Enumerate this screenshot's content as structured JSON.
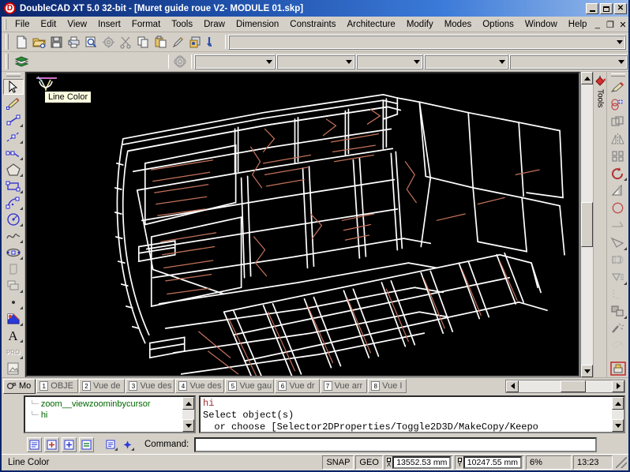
{
  "window": {
    "title": "DoubleCAD XT 5.0 32-bit - [Muret guide roue V2- MODULE 01.skp]",
    "logo": "D",
    "minimize": "_",
    "maximize": "□",
    "close": "✕"
  },
  "menu": {
    "items": [
      {
        "label": "File"
      },
      {
        "label": "Edit"
      },
      {
        "label": "View"
      },
      {
        "label": "Insert"
      },
      {
        "label": "Format"
      },
      {
        "label": "Tools"
      },
      {
        "label": "Draw"
      },
      {
        "label": "Dimension"
      },
      {
        "label": "Constraints"
      },
      {
        "label": "Architecture"
      },
      {
        "label": "Modify"
      },
      {
        "label": "Modes"
      },
      {
        "label": "Options"
      },
      {
        "label": "Window"
      },
      {
        "label": "Help"
      }
    ],
    "mdi": {
      "minimize": "_",
      "restore": "❐",
      "close": "✕"
    }
  },
  "toolbar_main": {
    "buttons": [
      {
        "name": "new-icon",
        "title": "New"
      },
      {
        "name": "open-icon",
        "title": "Open"
      },
      {
        "name": "save-icon",
        "title": "Save"
      },
      {
        "name": "print-icon",
        "title": "Print"
      },
      {
        "name": "print-preview-icon",
        "title": "Print Preview"
      },
      {
        "name": "settings-icon",
        "title": "Settings"
      },
      {
        "name": "cut-icon",
        "title": "Cut"
      },
      {
        "name": "copy-icon",
        "title": "Copy"
      },
      {
        "name": "paste-icon",
        "title": "Paste"
      },
      {
        "name": "format-painter-icon",
        "title": "Format Painter"
      },
      {
        "name": "paste-special-icon",
        "title": "Paste Special"
      },
      {
        "name": "undo-icon",
        "title": "Undo"
      }
    ],
    "style_combo_value": ""
  },
  "toolbar_props": {
    "layer_icon": "layers-icon",
    "pattern_icon": "pattern-icon",
    "combos": [
      {
        "name": "layer-combo",
        "value": ""
      },
      {
        "name": "color-combo",
        "value": ""
      },
      {
        "name": "linestyle-combo",
        "value": ""
      },
      {
        "name": "lineweight-combo",
        "value": ""
      },
      {
        "name": "textstyle-combo",
        "value": ""
      }
    ]
  },
  "left_toolbar": {
    "tools": [
      {
        "name": "select-tool",
        "glyph": "arrow",
        "active": true,
        "flyout": false
      },
      {
        "name": "pencil-tool",
        "glyph": "pencil",
        "active": false,
        "flyout": false
      },
      {
        "name": "line-tool",
        "glyph": "line",
        "active": false,
        "flyout": true
      },
      {
        "name": "construction-line-tool",
        "glyph": "cline",
        "active": false,
        "flyout": true
      },
      {
        "name": "polyline-tool",
        "glyph": "polyline",
        "active": false,
        "flyout": true
      },
      {
        "name": "polygon-tool",
        "glyph": "polygon",
        "active": false,
        "flyout": true
      },
      {
        "name": "rectangle-tool",
        "glyph": "rect",
        "active": false,
        "flyout": true
      },
      {
        "name": "arc-tool",
        "glyph": "arc",
        "active": false,
        "flyout": true
      },
      {
        "name": "circle-tool",
        "glyph": "circle",
        "active": false,
        "flyout": true
      },
      {
        "name": "spline-tool",
        "glyph": "spline",
        "active": false,
        "flyout": true
      },
      {
        "name": "ellipse-tool",
        "glyph": "ellipse",
        "active": false,
        "flyout": true
      },
      {
        "name": "curve-text-tool",
        "glyph": "qglyph",
        "active": false,
        "flyout": false
      },
      {
        "name": "solid-tool",
        "glyph": "solid",
        "active": false,
        "flyout": true
      },
      {
        "name": "point-tool",
        "glyph": "point",
        "active": false,
        "flyout": true
      },
      {
        "name": "hatch-tool",
        "glyph": "hatch",
        "active": false,
        "flyout": true
      },
      {
        "name": "text-tool",
        "glyph": "text",
        "active": false,
        "flyout": true
      },
      {
        "name": "pro-tool",
        "glyph": "pro",
        "active": false,
        "flyout": true
      },
      {
        "name": "image-tool",
        "glyph": "image",
        "active": false,
        "flyout": false
      }
    ],
    "pro_label": "PRO",
    "text_label": "A"
  },
  "right_toolbar": {
    "tools": [
      {
        "name": "paint-brush-tool",
        "glyph": "brush",
        "flyout": false
      },
      {
        "name": "boolean-tool",
        "glyph": "boolean",
        "flyout": false
      },
      {
        "name": "copy-entity-tool",
        "glyph": "copyent",
        "flyout": false
      },
      {
        "name": "mirror-tool",
        "glyph": "mirror",
        "flyout": false
      },
      {
        "name": "array-tool",
        "glyph": "array",
        "flyout": false
      },
      {
        "name": "rotate-tool",
        "glyph": "rotate",
        "flyout": true
      },
      {
        "name": "extrude-tool",
        "glyph": "extrude",
        "flyout": false
      },
      {
        "name": "revolve-tool",
        "glyph": "revolve",
        "flyout": false
      },
      {
        "name": "trim-tool",
        "glyph": "trim",
        "flyout": false
      },
      {
        "name": "chamfer-tool",
        "glyph": "chamfer",
        "flyout": true
      },
      {
        "name": "offset-tool",
        "glyph": "offset",
        "flyout": false
      },
      {
        "name": "explode-tool",
        "glyph": "explode",
        "flyout": true
      },
      {
        "name": "fillet-tool",
        "glyph": "fillet",
        "flyout": false
      },
      {
        "name": "group-tool",
        "glyph": "group",
        "flyout": true
      },
      {
        "name": "effects-tool",
        "glyph": "effects",
        "flyout": false
      },
      {
        "name": "arcmod-tool",
        "glyph": "arcmod",
        "flyout": false
      },
      {
        "name": "render-tool",
        "glyph": "render",
        "flyout": false
      }
    ],
    "dock_label": "Tools",
    "dock_icon": "paint-bucket-icon"
  },
  "canvas": {
    "tooltip": "Line Color",
    "background": "#000000",
    "line_color": "#ffffff",
    "detail_color": "#c4725a",
    "cursor": "line-color-cursor"
  },
  "tabs": {
    "items": [
      {
        "num": "",
        "label": "Mo",
        "active": true,
        "icon": "model-icon"
      },
      {
        "num": "1",
        "label": "OBJE",
        "active": false,
        "icon": "sheet-icon"
      },
      {
        "num": "2",
        "label": "Vue de",
        "active": false,
        "icon": "sheet-icon"
      },
      {
        "num": "3",
        "label": "Vue des",
        "active": false,
        "icon": "sheet-icon"
      },
      {
        "num": "4",
        "label": "Vue des",
        "active": false,
        "icon": "sheet-icon"
      },
      {
        "num": "5",
        "label": "Vue gau",
        "active": false,
        "icon": "sheet-icon"
      },
      {
        "num": "6",
        "label": "Vue dr",
        "active": false,
        "icon": "sheet-icon"
      },
      {
        "num": "7",
        "label": "Vue arr",
        "active": false,
        "icon": "sheet-icon"
      },
      {
        "num": "8",
        "label": "Vue I",
        "active": false,
        "icon": "sheet-icon"
      }
    ]
  },
  "history": {
    "entries": [
      {
        "text": "zoom__viewzoominbycursor"
      },
      {
        "text": "hi"
      }
    ]
  },
  "prompt": {
    "line1": "hi",
    "line2": "Select object(s)",
    "line3": "  or choose [Selector2DProperties/Toggle2D3D/MakeCopy/Keepo"
  },
  "cmdbar": {
    "buttons": [
      {
        "name": "properties-button",
        "glyph": "props"
      },
      {
        "name": "add-button",
        "glyph": "add"
      },
      {
        "name": "insert-button",
        "glyph": "insert"
      },
      {
        "name": "equal-button",
        "glyph": "equal"
      }
    ],
    "flats": [
      {
        "name": "list-flyout-button",
        "glyph": "listflat"
      },
      {
        "name": "snap-flyout-button",
        "glyph": "snapflat"
      }
    ],
    "label": "Command:",
    "value": ""
  },
  "statusbar": {
    "message": "Line Color",
    "snap": "SNAP",
    "geo": "GEO",
    "x_label": "X",
    "x_value": "13552.53 mm",
    "y_label": "Y",
    "y_value": "10247.55 mm",
    "zoom": "6%",
    "time": "13:23"
  }
}
